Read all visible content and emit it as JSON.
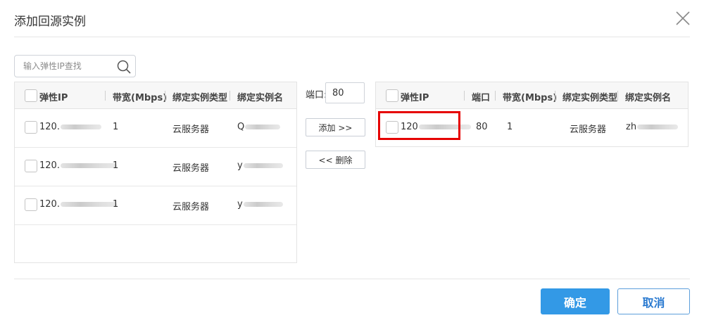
{
  "dialog": {
    "title": "添加回源实例",
    "close_icon": "close-icon"
  },
  "search": {
    "placeholder": "输入弹性IP查找",
    "icon": "search-icon"
  },
  "left_table": {
    "headers": [
      "弹性IP",
      "带宽(Mbps)",
      "绑定实例类型",
      "绑定实例名"
    ],
    "rows": [
      {
        "ip": "120.",
        "bandwidth": "1",
        "type": "云服务器",
        "name": "Q"
      },
      {
        "ip": "120.",
        "bandwidth": "1",
        "type": "云服务器",
        "name": "y"
      },
      {
        "ip": "120.",
        "bandwidth": "1",
        "type": "云服务器",
        "name": "y"
      }
    ]
  },
  "port": {
    "label": "端口:",
    "value": "80"
  },
  "buttons": {
    "add": "添加 >>",
    "remove": "<< 删除",
    "confirm": "确定",
    "cancel": "取消"
  },
  "right_table": {
    "headers": [
      "弹性IP",
      "端口",
      "带宽(Mbps)",
      "绑定实例类型",
      "绑定实例名"
    ],
    "rows": [
      {
        "ip": "120",
        "port": "80",
        "bandwidth": "1",
        "type": "云服务器",
        "name": "zh"
      }
    ]
  },
  "colors": {
    "primary": "#3399e6",
    "highlight_border": "#e60000"
  }
}
